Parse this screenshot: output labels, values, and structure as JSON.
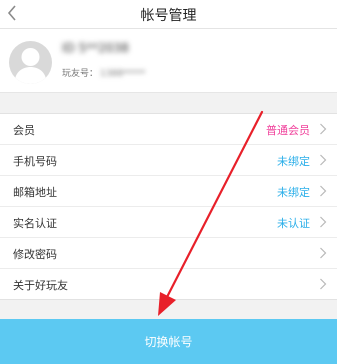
{
  "header": {
    "title": "帐号管理",
    "back_icon": "back-arrow-icon"
  },
  "profile": {
    "nickname": "ID 5**2038",
    "friend_id_label": "玩友号：",
    "friend_id_value": "1388*****"
  },
  "menu": {
    "items": [
      {
        "label": "会员",
        "value": "普通会员"
      },
      {
        "label": "手机号码",
        "value": "未绑定"
      },
      {
        "label": "邮箱地址",
        "value": "未绑定"
      },
      {
        "label": "实名认证",
        "value": "未认证"
      },
      {
        "label": "修改密码",
        "value": ""
      },
      {
        "label": "关于好玩友",
        "value": ""
      }
    ]
  },
  "footer": {
    "switch_label": "切换帐号"
  },
  "colors": {
    "member_value": "#f0409b",
    "link_value": "#29aee9",
    "button_bg": "#5cc9f2",
    "annotation_arrow": "#e8202a"
  }
}
